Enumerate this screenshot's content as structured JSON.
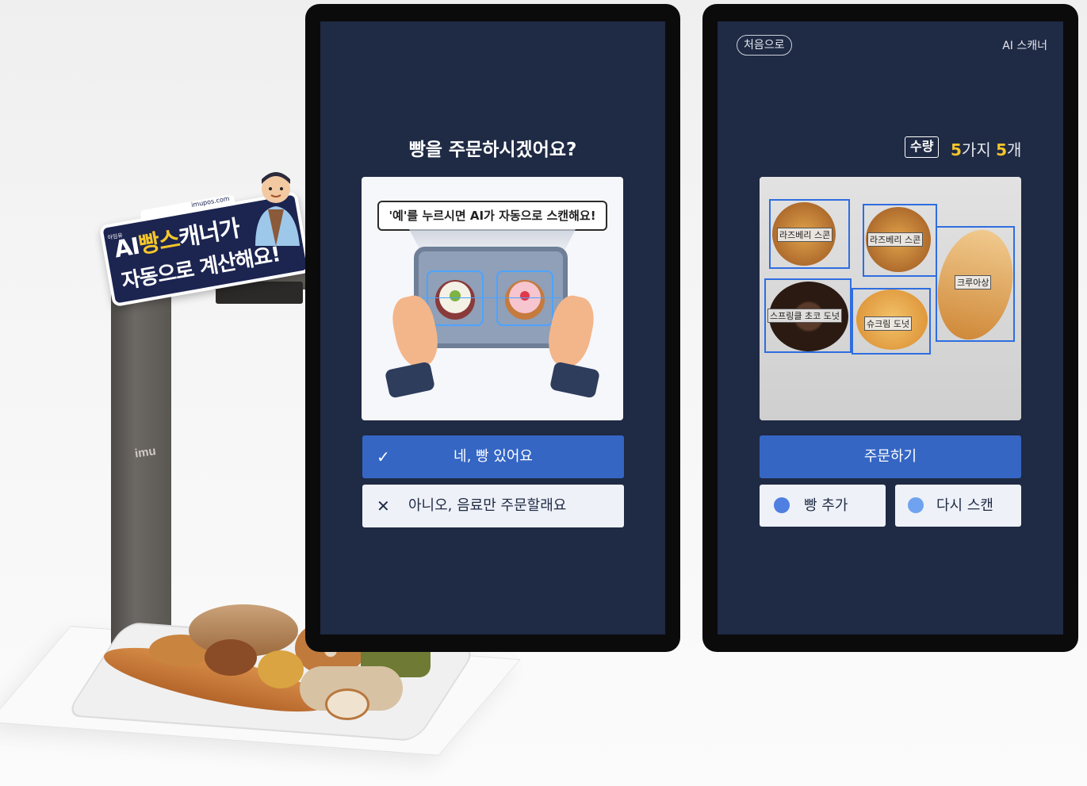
{
  "sign": {
    "small_left": "아임유",
    "small_url": "imupos.com",
    "line1_a": "AI",
    "line1_b": "빵스",
    "line1_c": "캐너가",
    "line2": "자동으로 계산해요!"
  },
  "stand": {
    "brand": "imu"
  },
  "screen1": {
    "question": "빵을 주문하시겠어요?",
    "speech": "'예'를 누르시면  AI가 자동으로 스캔해요!",
    "yes_icon": "check-icon",
    "yes_label": "네, 빵 있어요",
    "no_icon": "close-icon",
    "no_label": "아니오, 음료만 주문할래요"
  },
  "screen2": {
    "back_label": "처음으로",
    "app_title": "AI 스캐너",
    "qty_badge": "수량",
    "kinds_count": "5",
    "kinds_unit": "가지",
    "items_count": "5",
    "items_unit": "개",
    "detections": [
      "라즈베리 스콘",
      "라즈베리 스콘",
      "크루아상",
      "스프링클 초코 도넛",
      "슈크림 도넛"
    ],
    "order_label": "주문하기",
    "add_icon": "bread-add-icon",
    "add_label": "빵 추가",
    "rescan_icon": "rescan-icon",
    "rescan_label": "다시 스캔"
  },
  "colors": {
    "screen_bg": "#1f2a44",
    "primary": "#3566c4",
    "accent_yellow": "#f5c52a",
    "detection_box": "#2f6de0"
  }
}
